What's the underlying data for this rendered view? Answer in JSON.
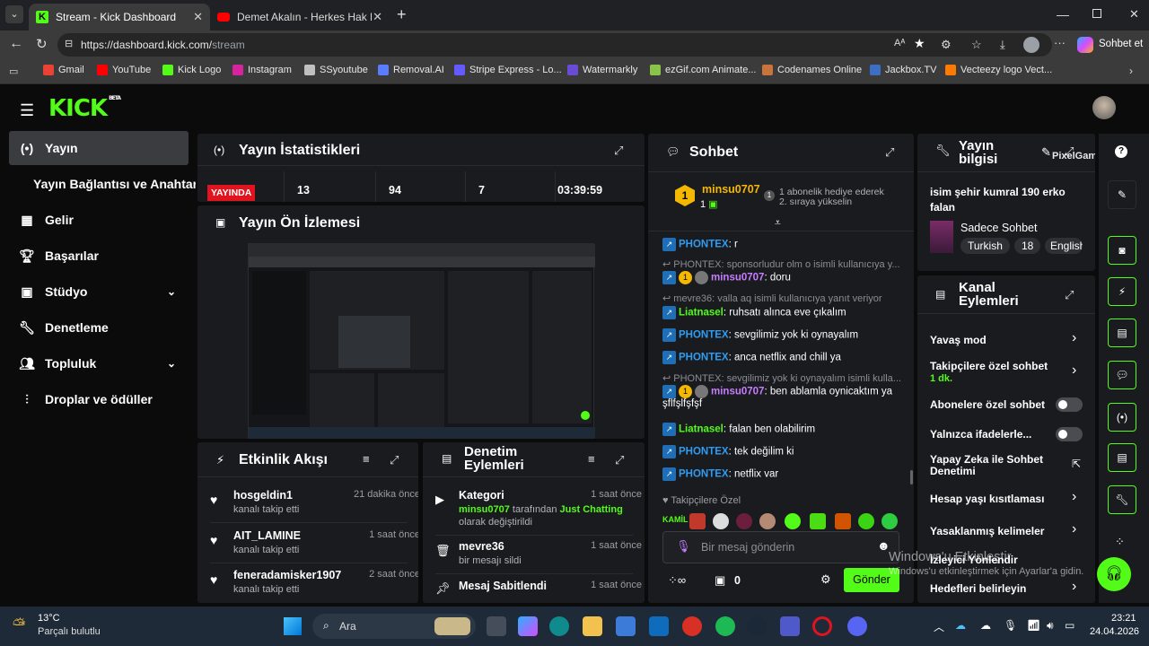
{
  "browser": {
    "tabs": [
      {
        "title": "Stream - Kick Dashboard"
      },
      {
        "title": "Demet Akalın - Herkes Hak Ettiği G"
      }
    ],
    "url_prefix": "https://dashboard.kick.com/",
    "url_path": "stream",
    "copilot_label": "Sohbet et",
    "bookmarks": [
      "Gmail",
      "YouTube",
      "Kick Logo",
      "Instagram",
      "SSyoutube",
      "Removal.AI",
      "Stripe Express - Lo...",
      "Watermarkly",
      "ezGif.com Animate...",
      "Codenames Online",
      "Jackbox.TV",
      "Vecteezy logo Vect..."
    ]
  },
  "app": {
    "logo": "KICK",
    "logo_beta": "BETA"
  },
  "sidebar": {
    "items": [
      {
        "label": "Yayın",
        "icon": "broadcast-icon"
      },
      {
        "label": "Yayın Bağlantısı ve Anahtarı",
        "icon": ""
      },
      {
        "label": "Gelir",
        "icon": "revenue-icon"
      },
      {
        "label": "Başarılar",
        "icon": "trophy-icon"
      },
      {
        "label": "Stüdyo",
        "icon": "studio-icon"
      },
      {
        "label": "Denetleme",
        "icon": "wrench-icon"
      },
      {
        "label": "Topluluk",
        "icon": "community-icon"
      },
      {
        "label": "Droplar ve ödüller",
        "icon": "drops-icon"
      }
    ]
  },
  "stats": {
    "title": "Yayın İstatistikleri",
    "live_badge": "YAYINDA",
    "values": [
      "13",
      "94",
      "7",
      "03:39:59"
    ]
  },
  "preview": {
    "title": "Yayın Ön İzlemesi"
  },
  "activity": {
    "title": "Etkinlik Akışı",
    "items": [
      {
        "name": "hosgeldin1",
        "action": "kanalı takip etti",
        "time": "21 dakika önce"
      },
      {
        "name": "AIT_LAMINE",
        "action": "kanalı takip etti",
        "time": "1 saat önce"
      },
      {
        "name": "feneradamisker1907",
        "action": "kanalı takip etti",
        "time": "2 saat önce"
      }
    ]
  },
  "moderation": {
    "title_line1": "Denetim",
    "title_line2": "Eylemleri",
    "items": [
      {
        "title": "Kategori",
        "user": "minsu0707",
        "mid": " tarafından ",
        "target": "Just Chatting",
        "rest": "olarak değiştirildi",
        "time": "1 saat önce"
      },
      {
        "title": "mevre36",
        "sub": "bir mesajı sildi",
        "time": "1 saat önce"
      },
      {
        "title": "Mesaj Sabitlendi",
        "time": "1 saat önce"
      }
    ]
  },
  "chat": {
    "title": "Sohbet",
    "top_user": "minsu0707",
    "top_count": "1",
    "gift_rank": "1",
    "gift_line1": "1 abonelik hediye ederek",
    "gift_line2": "2. sıraya yükselin",
    "messages": [
      {
        "user": "PHONTEX",
        "text": ": r",
        "color": "#2f9cf1"
      },
      {
        "reply": "PHONTEX: sponsorludur olm o isimli kullanıcıya y..."
      },
      {
        "user": "minsu0707",
        "text": ": doru",
        "color": "#c77dff",
        "badges": true
      },
      {
        "reply": "mevre36: valla aq isimli kullanıcıya yanıt veriyor"
      },
      {
        "user": "Liatnasel",
        "text": ": ruhsatı alınca eve çıkalım",
        "color": "#53fc18"
      },
      {
        "user": "PHONTEX",
        "text": ": sevgilimiz yok ki oynayalım",
        "color": "#2f9cf1"
      },
      {
        "user": "PHONTEX",
        "text": ": anca netflix and chill ya",
        "color": "#2f9cf1"
      },
      {
        "reply": "PHONTEX: sevgilimiz yok ki oynayalım isimli kulla..."
      },
      {
        "user": "minsu0707",
        "text": ": ben ablamla oynicaktım ya",
        "text2": "şflfşlfşfşf",
        "color": "#c77dff",
        "badges": true
      },
      {
        "user": "Liatnasel",
        "text": ": falan ben olabilirim",
        "color": "#53fc18"
      },
      {
        "user": "PHONTEX",
        "text": ": tek değilim ki",
        "color": "#2f9cf1"
      },
      {
        "user": "PHONTEX",
        "text": ": netflix var",
        "color": "#2f9cf1"
      }
    ],
    "followers_only": "Takipçilere Özel",
    "emotes": [
      "KAMİL",
      "",
      "",
      "",
      "",
      "",
      "",
      "",
      "",
      ""
    ],
    "input_placeholder": "Bir mesaj gönderin",
    "viewers_count": "0",
    "send_label": "Gönder"
  },
  "stream_info": {
    "title_line1": "Yayın",
    "title_line2": "bilgisi",
    "stream_title": "isim şehir kumral 190 erko falan",
    "category": "Sadece Sohbet",
    "tags": [
      "Turkish",
      "18",
      "English"
    ],
    "overlay": "PixelGame"
  },
  "channel_actions": {
    "title_line1": "Kanal",
    "title_line2": "Eylemleri",
    "items": [
      {
        "label": "Yavaş mod",
        "control": "chevron"
      },
      {
        "label": "Takipçilere özel sohbet",
        "sub": "1 dk.",
        "control": "chevron"
      },
      {
        "label": "Abonelere özel sohbet",
        "control": "toggle"
      },
      {
        "label": "Yalnızca ifadelerle...",
        "control": "toggle"
      },
      {
        "label": "Yapay Zeka ile Sohbet Denetimi",
        "control": "external"
      },
      {
        "label": "Hesap yaşı kısıtlaması",
        "control": "chevron"
      },
      {
        "label": "Yasaklanmış kelimeler",
        "control": "chevron"
      },
      {
        "label": "İzleyici Yönlendir",
        "control": "none"
      },
      {
        "label": "Hedefleri belirleyin",
        "control": "chevron"
      }
    ]
  },
  "watermark": {
    "line1": "Windows'u Etkinleştir",
    "line2": "Windows'u etkinleştirmek için Ayarlar'a gidin."
  },
  "taskbar": {
    "temp": "13°C",
    "weather": "Parçalı bulutlu",
    "search": "Ara",
    "time": "23:21",
    "date": "24.04.2026"
  },
  "colors": {
    "kick_green": "#53fc18",
    "live_red": "#e0141e",
    "panel": "#191b1f"
  }
}
